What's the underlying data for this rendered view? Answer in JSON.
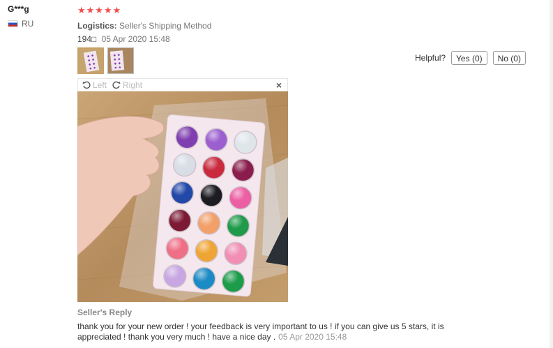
{
  "user": {
    "name": "G***g",
    "country": "RU"
  },
  "review": {
    "rating": 5,
    "stars_text": "★★★★★",
    "logistics_label": "Logistics:",
    "logistics_value": "Seller's Shipping Method",
    "order_number": "194□",
    "date": "05 Apr 2020 15:48"
  },
  "helpful": {
    "label": "Helpful?",
    "yes": "Yes (0)",
    "no": "No (0)"
  },
  "viewer": {
    "left_label": "Left",
    "right_label": "Right",
    "close_symbol": "×"
  },
  "reply": {
    "title": "Seller's Reply",
    "text": "thank you for your new order ! your feedback is very important to us ! if you can give us 5 stars, it is appreciated ! thank you very much ! have a nice day .",
    "date": "05 Apr 2020 15:48"
  },
  "palette_colors": [
    "#7f3fb0",
    "#9b5fcf",
    "#dfe6ea",
    "#d8dde6",
    "#c92a3e",
    "#8a1d4c",
    "#2248a8",
    "#1c1c22",
    "#ec5fa4",
    "#7c1a34",
    "#f2a06a",
    "#1f9a4a",
    "#ef6f86",
    "#efa535",
    "#f08fb3",
    "#c7a6e2",
    "#1c8ac4",
    "#1c9c4b"
  ]
}
